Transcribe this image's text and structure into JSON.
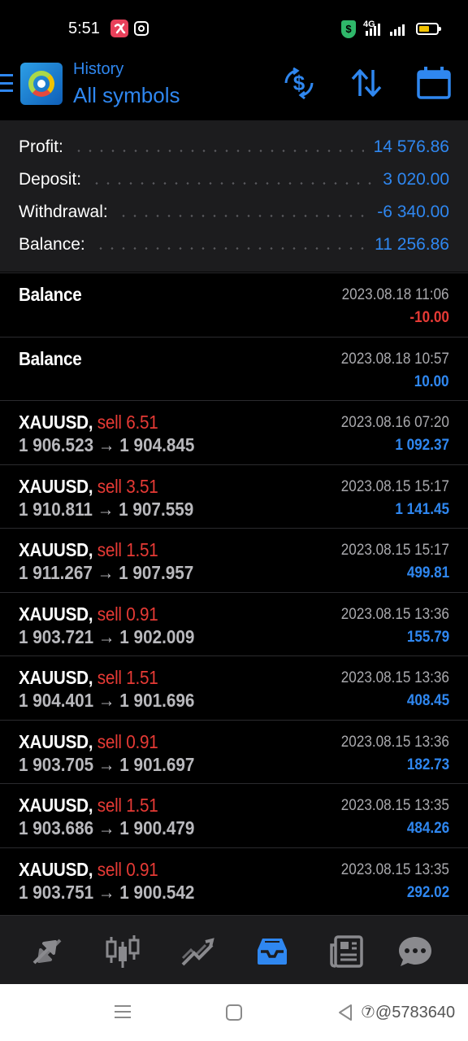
{
  "status_bar": {
    "time": "5:51",
    "network": "4G",
    "shield_glyph": "$",
    "icons": [
      "app-alpha-icon",
      "instagram-icon",
      "vpn-shield-icon",
      "signal-icon",
      "battery-icon"
    ]
  },
  "header": {
    "subtitle": "History",
    "title": "All symbols",
    "icons": [
      "menu-icon",
      "app-logo",
      "deposit-filter-icon",
      "sort-icon",
      "calendar-icon"
    ]
  },
  "summary": [
    {
      "label": "Profit:",
      "value": "14 576.86"
    },
    {
      "label": "Deposit:",
      "value": "3 020.00"
    },
    {
      "label": "Withdrawal:",
      "value": "-6 340.00"
    },
    {
      "label": "Balance:",
      "value": "11 256.86"
    }
  ],
  "deals": [
    {
      "symbol": "Balance",
      "type": "",
      "prices": "",
      "time": "2023.08.18 11:06",
      "profit": "-10.00",
      "profit_color": "#e63a35"
    },
    {
      "symbol": "Balance",
      "type": "",
      "prices": "",
      "time": "2023.08.18 10:57",
      "profit": "10.00",
      "profit_color": "#2f87f0"
    },
    {
      "symbol": "XAUUSD,",
      "type": " sell 6.51",
      "prices": "1 906.523 → 1 904.845",
      "time": "2023.08.16 07:20",
      "profit": "1 092.37",
      "profit_color": "#2f87f0"
    },
    {
      "symbol": "XAUUSD,",
      "type": " sell 3.51",
      "prices": "1 910.811 → 1 907.559",
      "time": "2023.08.15 15:17",
      "profit": "1 141.45",
      "profit_color": "#2f87f0"
    },
    {
      "symbol": "XAUUSD,",
      "type": " sell 1.51",
      "prices": "1 911.267 → 1 907.957",
      "time": "2023.08.15 15:17",
      "profit": "499.81",
      "profit_color": "#2f87f0"
    },
    {
      "symbol": "XAUUSD,",
      "type": " sell 0.91",
      "prices": "1 903.721 → 1 902.009",
      "time": "2023.08.15 13:36",
      "profit": "155.79",
      "profit_color": "#2f87f0"
    },
    {
      "symbol": "XAUUSD,",
      "type": " sell 1.51",
      "prices": "1 904.401 → 1 901.696",
      "time": "2023.08.15 13:36",
      "profit": "408.45",
      "profit_color": "#2f87f0"
    },
    {
      "symbol": "XAUUSD,",
      "type": " sell 0.91",
      "prices": "1 903.705 → 1 901.697",
      "time": "2023.08.15 13:36",
      "profit": "182.73",
      "profit_color": "#2f87f0"
    },
    {
      "symbol": "XAUUSD,",
      "type": " sell 1.51",
      "prices": "1 903.686 → 1 900.479",
      "time": "2023.08.15 13:35",
      "profit": "484.26",
      "profit_color": "#2f87f0"
    },
    {
      "symbol": "XAUUSD,",
      "type": " sell 0.91",
      "prices": "1 903.751 → 1 900.542",
      "time": "2023.08.15 13:35",
      "profit": "292.02",
      "profit_color": "#2f87f0"
    }
  ],
  "bottom_nav": [
    {
      "name": "quotes-tab",
      "icon": "quotes-arrows-icon",
      "active": false
    },
    {
      "name": "chart-tab",
      "icon": "candlestick-icon",
      "active": false
    },
    {
      "name": "trade-tab",
      "icon": "trend-line-icon",
      "active": false
    },
    {
      "name": "history-tab",
      "icon": "inbox-icon",
      "active": true
    },
    {
      "name": "news-tab",
      "icon": "newspaper-icon",
      "active": false
    },
    {
      "name": "messages-tab",
      "icon": "chat-bubble-icon",
      "active": false
    }
  ],
  "system_nav": {
    "watermark": "⑦@5783640"
  },
  "colors": {
    "accent": "#2f87f0",
    "loss": "#e63a35",
    "sell": "#e63a35",
    "panel": "#1c1c1e",
    "background": "#000000"
  }
}
